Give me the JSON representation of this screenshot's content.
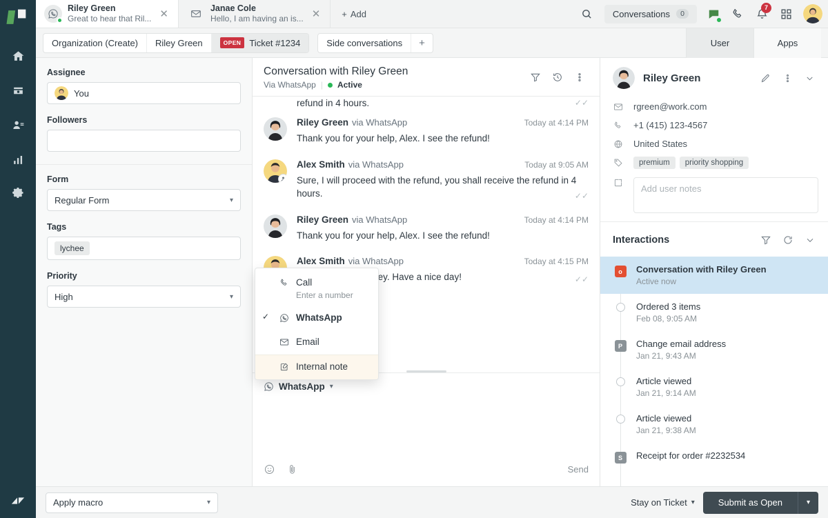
{
  "nav": {
    "items": [
      {
        "name": "home-icon",
        "label": "Home"
      },
      {
        "name": "views-icon",
        "label": "Views"
      },
      {
        "name": "customers-icon",
        "label": "Customers"
      },
      {
        "name": "reporting-icon",
        "label": "Reporting"
      },
      {
        "name": "settings-icon",
        "label": "Admin"
      }
    ],
    "logo_label": "Zendesk"
  },
  "tabstrip": {
    "tabs": [
      {
        "name": "Riley Green",
        "snippet": "Great to hear that Ril...",
        "channel": "whatsapp",
        "active": true,
        "online": true
      },
      {
        "name": "Janae Cole",
        "snippet": "Hello, I am having an is...",
        "channel": "email",
        "active": false,
        "online": false
      }
    ],
    "add_label": "Add",
    "search_label": "Search",
    "conversations_label": "Conversations",
    "conversations_count": "0",
    "notifications_badge": "7"
  },
  "crumbs": {
    "items": [
      {
        "label": "Organization (Create)",
        "current": false
      },
      {
        "label": "Riley Green",
        "current": false
      },
      {
        "label": "Ticket #1234",
        "current": true,
        "badge": "OPEN"
      }
    ],
    "side_conversations_label": "Side conversations",
    "add_side_label": "+"
  },
  "panel_tabs": {
    "user": "User",
    "apps": "Apps"
  },
  "properties": {
    "assignee": {
      "label": "Assignee",
      "value": "You"
    },
    "followers": {
      "label": "Followers",
      "value": ""
    },
    "form": {
      "label": "Form",
      "value": "Regular Form"
    },
    "tags": {
      "label": "Tags",
      "chips": [
        "lychee"
      ]
    },
    "priority": {
      "label": "Priority",
      "value": "High"
    }
  },
  "conversation": {
    "title": "Conversation with Riley Green",
    "via": "Via WhatsApp",
    "status": "Active",
    "cut_message_text": "refund in 4 hours.",
    "messages": [
      {
        "author": "Riley Green",
        "via": "via WhatsApp",
        "time": "Today at 4:14 PM",
        "text": "Thank you for your help, Alex. I see the refund!",
        "is_agent": false,
        "ticks": false
      },
      {
        "author": "Alex Smith",
        "via": "via WhatsApp",
        "time": "Today at 9:05 AM",
        "text": "Sure, I will proceed with the refund, you shall receive the refund in 4 hours.",
        "is_agent": true,
        "ticks": true
      },
      {
        "author": "Riley Green",
        "via": "via WhatsApp",
        "time": "Today at 4:14 PM",
        "text": "Thank you for your help, Alex. I see the refund!",
        "is_agent": false,
        "ticks": false
      },
      {
        "author": "Alex Smith",
        "via": "via WhatsApp",
        "time": "Today at 4:15 PM",
        "text": "You're welcome, Riley. Have a nice day!",
        "is_agent": true,
        "ticks": true
      }
    ]
  },
  "channel_menu": {
    "items": [
      {
        "label": "Call",
        "sub": "Enter a number",
        "icon": "phone-icon",
        "checked": false,
        "highlighted": false
      },
      {
        "label": "WhatsApp",
        "sub": "",
        "icon": "whatsapp-icon",
        "checked": true,
        "highlighted": false
      },
      {
        "label": "Email",
        "sub": "",
        "icon": "envelope-icon",
        "checked": false,
        "highlighted": false
      },
      {
        "label": "Internal note",
        "sub": "",
        "icon": "note-icon",
        "checked": false,
        "highlighted": true
      }
    ]
  },
  "composer": {
    "channel_label": "WhatsApp",
    "send_label": "Send",
    "placeholder": ""
  },
  "user_panel": {
    "name": "Riley Green",
    "email": "rgreen@work.com",
    "phone": "+1 (415) 123-4567",
    "country": "United States",
    "tags": [
      "premium",
      "priority shopping"
    ],
    "notes_placeholder": "Add user notes"
  },
  "interactions": {
    "title": "Interactions",
    "items": [
      {
        "title": "Conversation with Riley Green",
        "sub": "Active now",
        "marker": "square-orange",
        "marker_letter": "o",
        "selected": true
      },
      {
        "title": "Ordered 3 items",
        "sub": "Feb 08, 9:05 AM",
        "marker": "ring",
        "marker_letter": "",
        "selected": false
      },
      {
        "title": "Change email address",
        "sub": "Jan 21, 9:43 AM",
        "marker": "square-grey",
        "marker_letter": "P",
        "selected": false
      },
      {
        "title": "Article viewed",
        "sub": "Jan 21, 9:14 AM",
        "marker": "ring",
        "marker_letter": "",
        "selected": false
      },
      {
        "title": "Article viewed",
        "sub": "Jan 21, 9:38 AM",
        "marker": "ring",
        "marker_letter": "",
        "selected": false
      },
      {
        "title": "Receipt for order #2232534",
        "sub": "",
        "marker": "square-grey",
        "marker_letter": "S",
        "selected": false
      }
    ]
  },
  "footer": {
    "macro_label": "Apply macro",
    "stay_label": "Stay on Ticket",
    "submit_label": "Submit as Open"
  },
  "colors": {
    "nav_bg": "#1f3a44",
    "accent_red": "#cc3340",
    "online_green": "#2ab757",
    "selected_blue": "#cfe5f4",
    "submit_dark": "#3f4b52",
    "note_highlight": "#fdf7ed"
  }
}
